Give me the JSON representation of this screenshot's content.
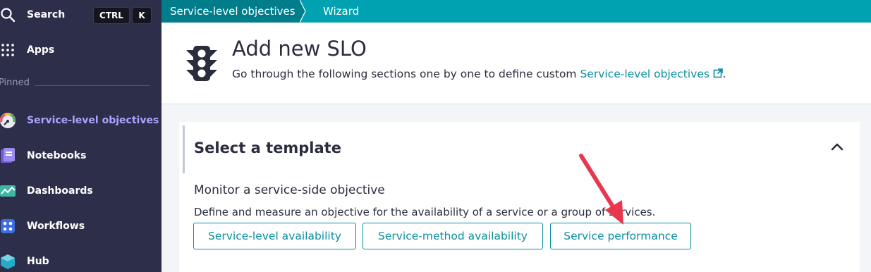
{
  "sidebar": {
    "search_label": "Search",
    "shortcut_ctrl": "CTRL",
    "shortcut_k": "K",
    "apps_label": "Apps",
    "pinned_label": "Pinned",
    "items": [
      {
        "label": "Service-level objectives",
        "icon": "gauge-icon",
        "active": true
      },
      {
        "label": "Notebooks",
        "icon": "notebook-icon"
      },
      {
        "label": "Dashboards",
        "icon": "dashboard-icon"
      },
      {
        "label": "Workflows",
        "icon": "workflow-icon"
      },
      {
        "label": "Hub",
        "icon": "hub-icon"
      }
    ]
  },
  "breadcrumb": {
    "items": [
      "Service-level objectives",
      "Wizard"
    ]
  },
  "header": {
    "title": "Add new SLO",
    "desc_prefix": "Go through the following sections one by one to define custom ",
    "desc_link": "Service-level objectives",
    "desc_suffix": "."
  },
  "template_section": {
    "title": "Select a template",
    "subheading": "Monitor a service-side objective",
    "description": "Define and measure an objective for the availability of a service or a group of services.",
    "buttons": [
      "Service-level availability",
      "Service-method availability",
      "Service performance"
    ]
  },
  "colors": {
    "sidebar_bg": "#2d2f4a",
    "topbar": "#00a1b0",
    "accent": "#0a8fa0",
    "annotation_arrow": "#e8384f"
  }
}
